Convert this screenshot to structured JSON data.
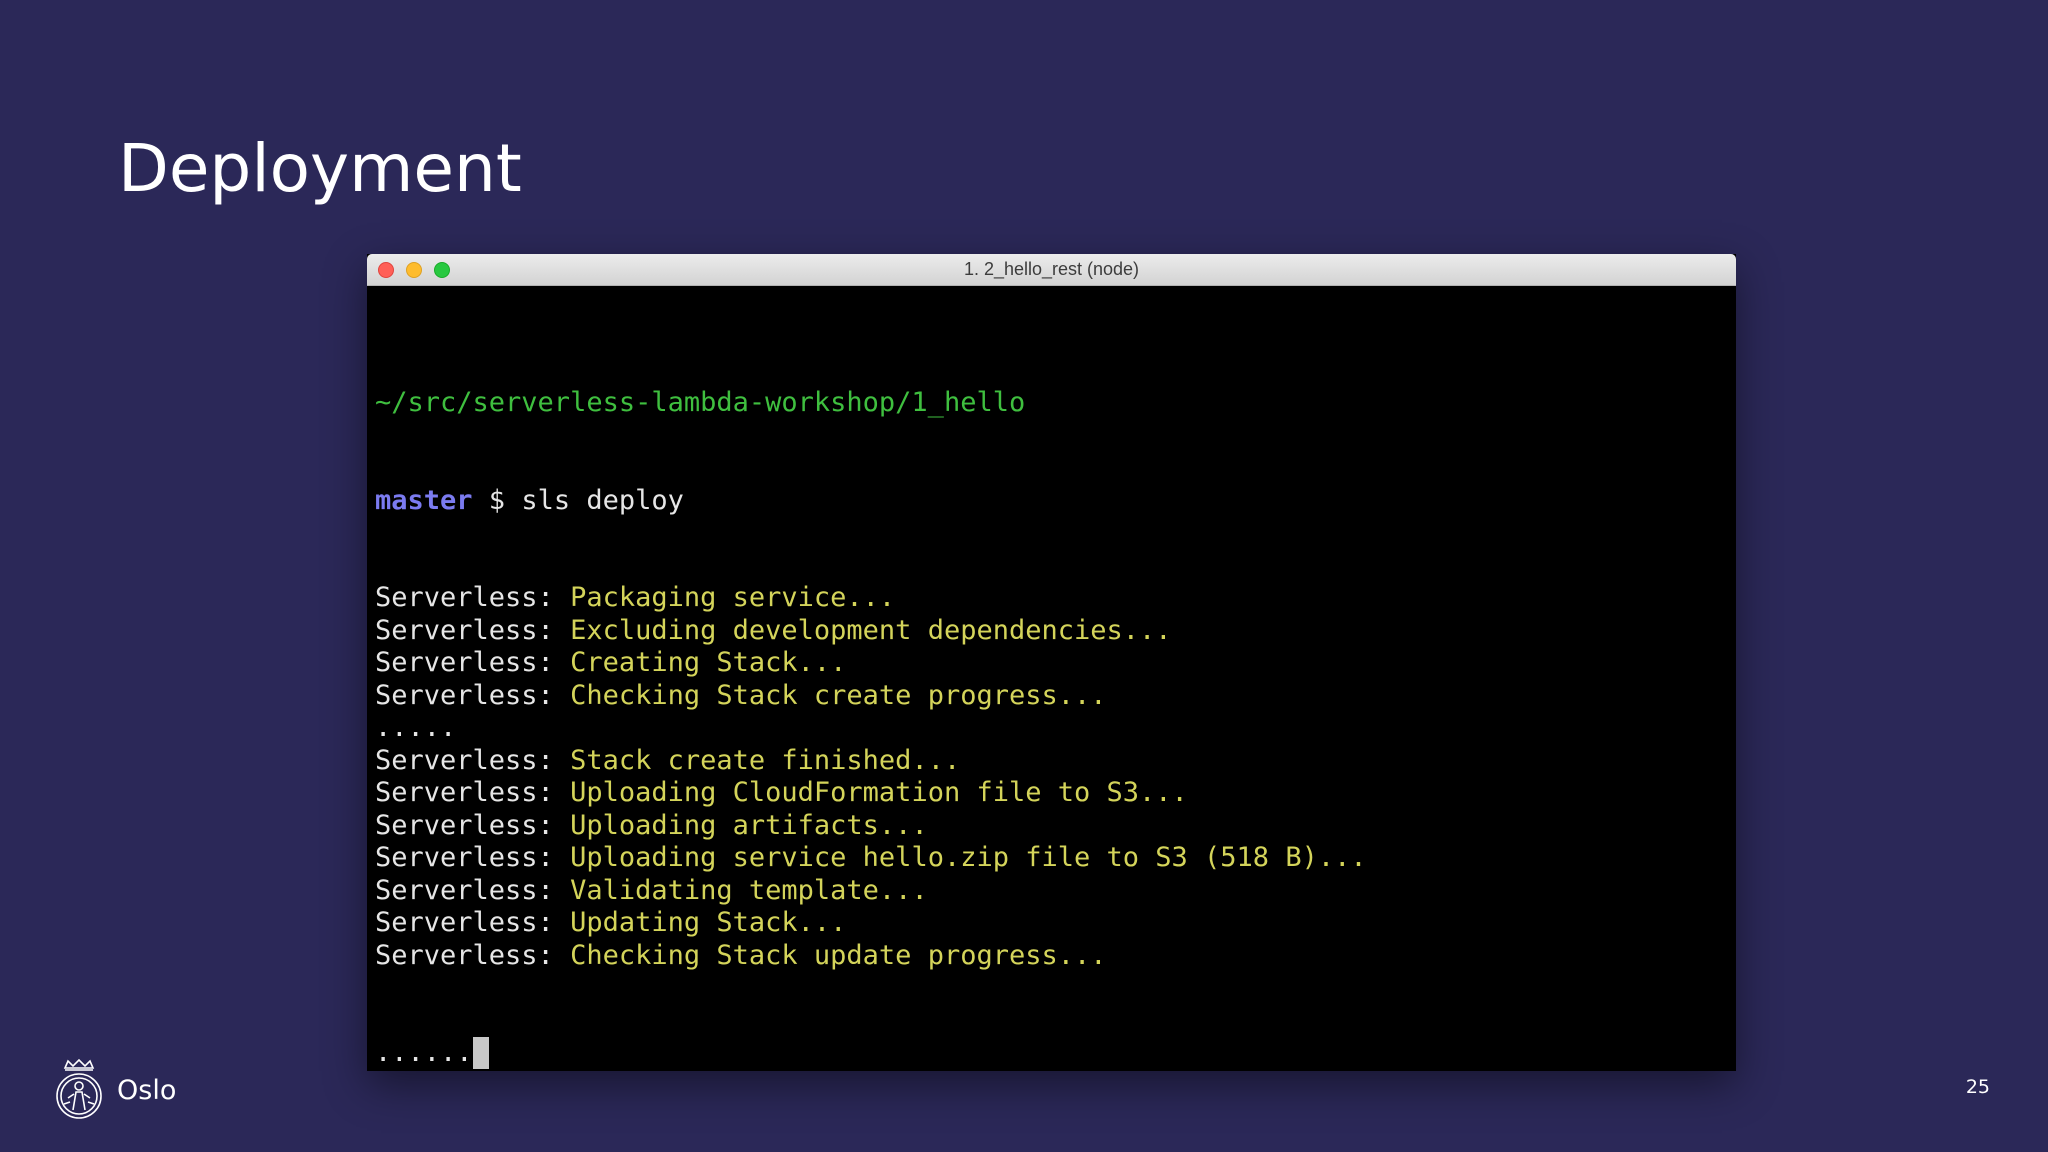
{
  "slide": {
    "title": "Deployment",
    "page_number": "25"
  },
  "footer": {
    "brand": "Oslo",
    "logo_icon": "oslo-city-seal-icon"
  },
  "terminal": {
    "window_title": "1. 2_hello_rest (node)",
    "cwd": "~/src/serverless-lambda-workshop/1_hello",
    "branch": "master",
    "prompt_rest": " $ sls deploy",
    "lines": [
      {
        "label": "Serverless: ",
        "msg": "Packaging service..."
      },
      {
        "label": "Serverless: ",
        "msg": "Excluding development dependencies..."
      },
      {
        "label": "Serverless: ",
        "msg": "Creating Stack..."
      },
      {
        "label": "Serverless: ",
        "msg": "Checking Stack create progress..."
      },
      {
        "label": ".....",
        "msg": ""
      },
      {
        "label": "Serverless: ",
        "msg": "Stack create finished..."
      },
      {
        "label": "Serverless: ",
        "msg": "Uploading CloudFormation file to S3..."
      },
      {
        "label": "Serverless: ",
        "msg": "Uploading artifacts..."
      },
      {
        "label": "Serverless: ",
        "msg": "Uploading service hello.zip file to S3 (518 B)..."
      },
      {
        "label": "Serverless: ",
        "msg": "Validating template..."
      },
      {
        "label": "Serverless: ",
        "msg": "Updating Stack..."
      },
      {
        "label": "Serverless: ",
        "msg": "Checking Stack update progress..."
      }
    ],
    "last_line": "......",
    "colors": {
      "background": "#000000",
      "cwd": "#3fbf3f",
      "branch": "#7b7bf0",
      "message": "#d4d45a",
      "text": "#e6e6e6"
    }
  }
}
